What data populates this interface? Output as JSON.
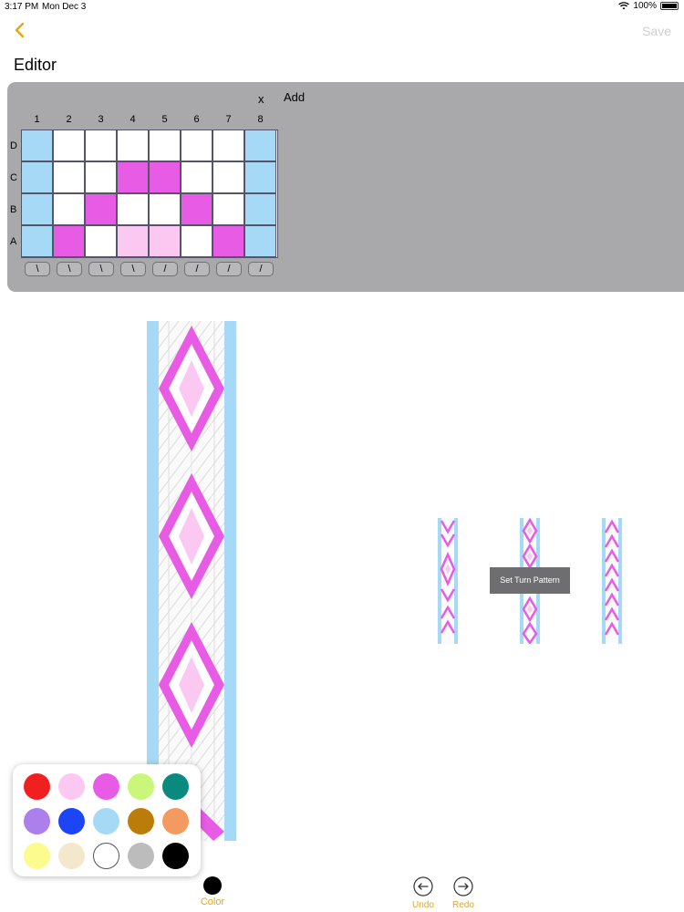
{
  "status": {
    "time": "3:17 PM",
    "date": "Mon Dec 3",
    "battery": "100%"
  },
  "nav": {
    "save_label": "Save",
    "back_icon": "chevron-left-icon"
  },
  "editor": {
    "title": "Editor",
    "x_label": "x",
    "add_label": "Add",
    "columns": [
      "1",
      "2",
      "3",
      "4",
      "5",
      "6",
      "7",
      "8"
    ],
    "rows": [
      "D",
      "C",
      "B",
      "A"
    ],
    "grid_colors": [
      [
        "#a6d9f5",
        "#ffffff",
        "#ffffff",
        "#ffffff",
        "#ffffff",
        "#ffffff",
        "#ffffff",
        "#a6d9f5"
      ],
      [
        "#a6d9f5",
        "#ffffff",
        "#ffffff",
        "#e85ce5",
        "#e85ce5",
        "#ffffff",
        "#ffffff",
        "#a6d9f5"
      ],
      [
        "#a6d9f5",
        "#ffffff",
        "#e85ce5",
        "#ffffff",
        "#ffffff",
        "#e85ce5",
        "#ffffff",
        "#a6d9f5"
      ],
      [
        "#a6d9f5",
        "#e85ce5",
        "#ffffff",
        "#fbc8f2",
        "#fbc8f2",
        "#ffffff",
        "#e85ce5",
        "#a6d9f5"
      ]
    ],
    "directions": [
      "\\",
      "\\",
      "\\",
      "\\",
      "/",
      "/",
      "/",
      "/"
    ]
  },
  "preview": {
    "tooltip": "Set Turn Pattern"
  },
  "palette": {
    "colors": [
      "#f02020",
      "#fbc8f2",
      "#e85ce5",
      "#caf77a",
      "#0a8a7e",
      "#ac80ec",
      "#1c45f5",
      "#a6d9f5",
      "#bb7c0a",
      "#f39a60",
      "#fbfb8e",
      "#f4e8cc",
      "#ffffff",
      "#bcbcbc",
      "#000000"
    ]
  },
  "toolbar": {
    "color_label": "Color",
    "undo_label": "Undo",
    "redo_label": "Redo"
  },
  "theme": {
    "accent": "#e8a413",
    "panel": "#a9a9ab",
    "edge": "#a6d9f5",
    "pink": "#e85ce5",
    "light_pink": "#fbc8f2"
  }
}
